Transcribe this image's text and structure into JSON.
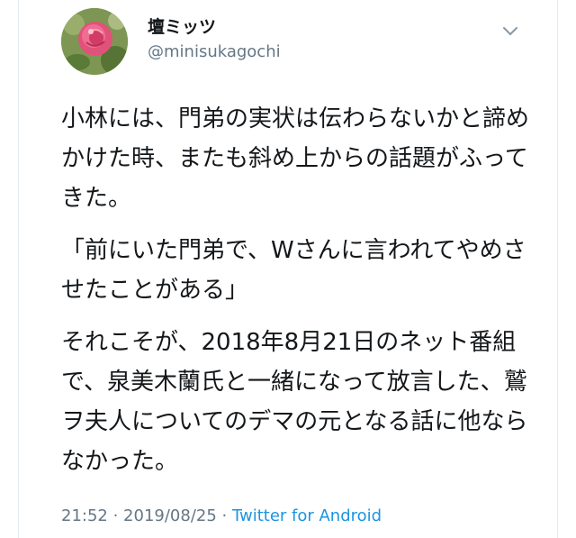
{
  "user": {
    "display_name": "壇ミッツ",
    "handle": "@minisukagochi"
  },
  "tweet": {
    "paragraphs": [
      "小林には、門弟の実状は伝わらないかと諦めかけた時、またも斜め上からの話題がふってきた。",
      "「前にいた門弟で、Wさんに言われてやめさせたことがある」",
      "それこそが、2018年8月21日のネット番組で、泉美木蘭氏と一緒になって放言した、鷲ヲ夫人についてのデマの元となる話に他ならなかった。"
    ],
    "time": "21:52",
    "separator": " · ",
    "date": "2019/08/25",
    "source": "Twitter for Android"
  },
  "icons": {
    "avatar": "rose-photo-avatar",
    "menu": "chevron-down-icon"
  },
  "colors": {
    "text": "#14171a",
    "secondary": "#657786",
    "link": "#1b95e0"
  }
}
